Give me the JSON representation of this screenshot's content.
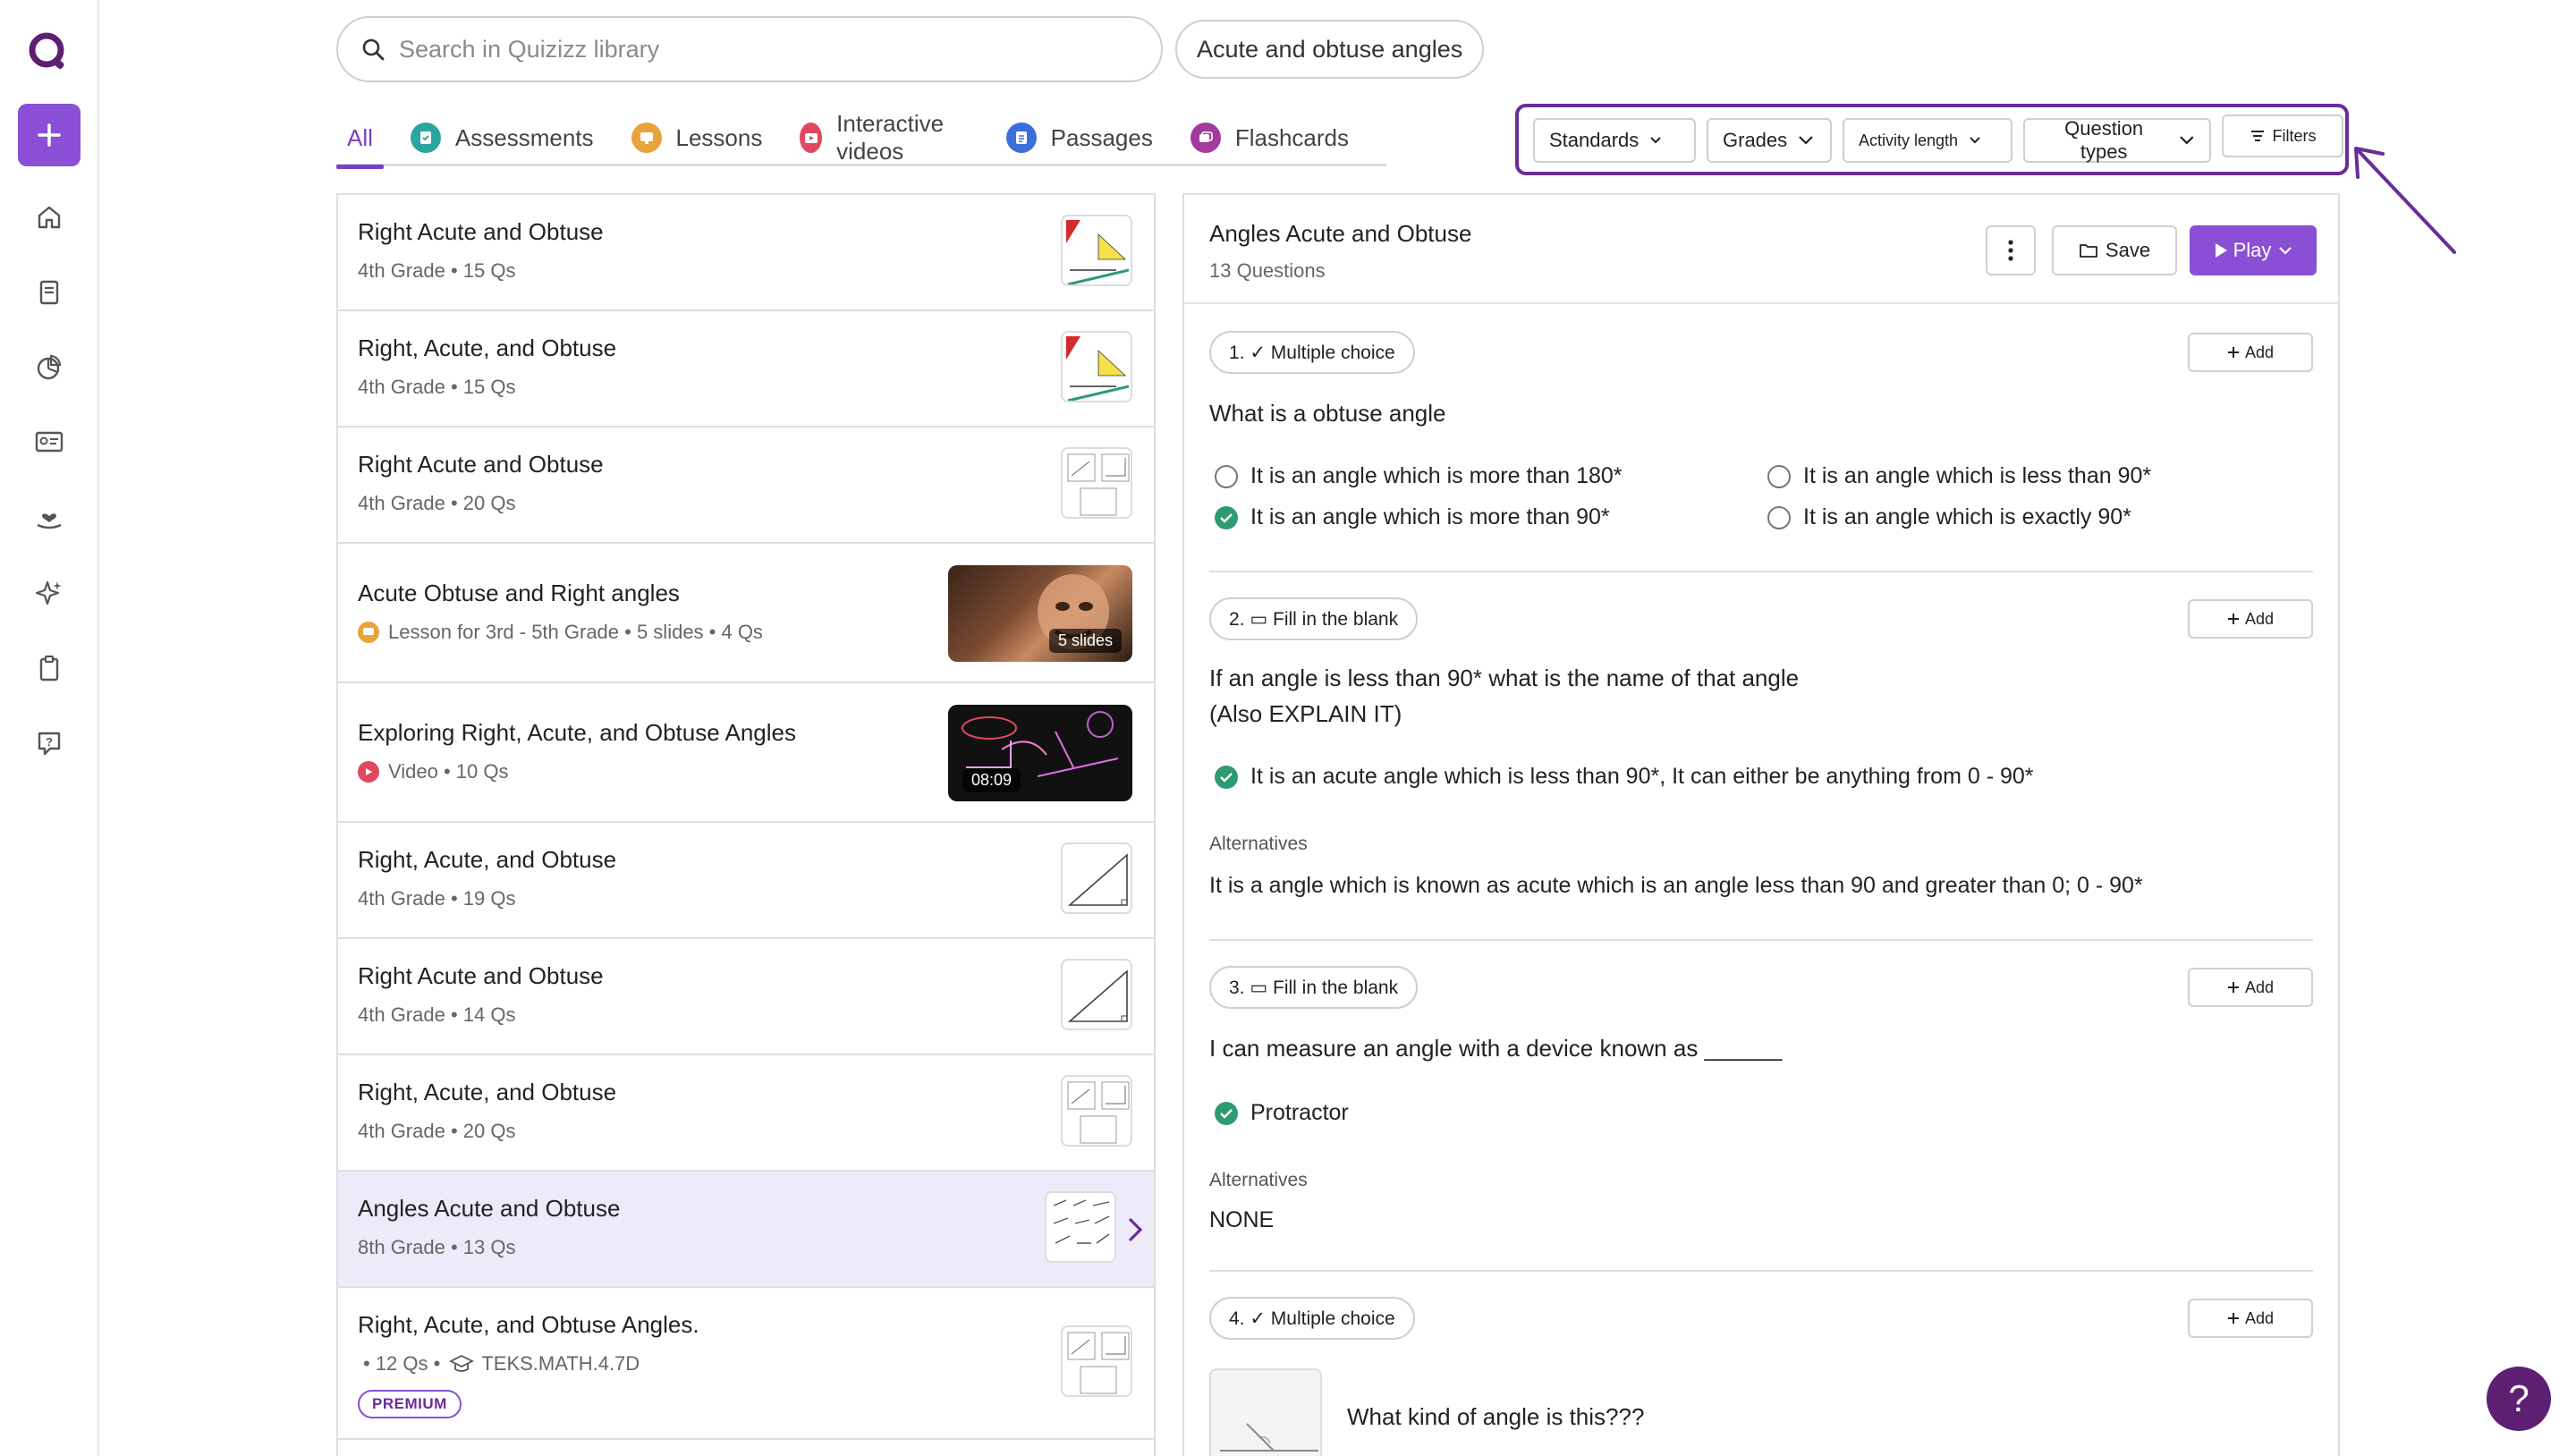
{
  "search": {
    "placeholder": "Search in Quizizz library"
  },
  "query_chip": "Acute and obtuse angles",
  "tabs": [
    {
      "label": "All",
      "color": "#7c3fc4"
    },
    {
      "label": "Assessments",
      "color": "#2aa6a0"
    },
    {
      "label": "Lessons",
      "color": "#e9a33b"
    },
    {
      "label": "Interactive videos",
      "color": "#e0485f"
    },
    {
      "label": "Passages",
      "color": "#3b6fd9"
    },
    {
      "label": "Flashcards",
      "color": "#a33a9e"
    }
  ],
  "filters": {
    "standards": "Standards",
    "grades": "Grades",
    "activity_length": "Activity length",
    "question_types": "Question types",
    "filters": "Filters"
  },
  "results": [
    {
      "title": "Right Acute and Obtuse",
      "meta": "4th Grade • 15 Qs"
    },
    {
      "title": "Right, Acute, and Obtuse",
      "meta": "4th Grade • 15 Qs"
    },
    {
      "title": "Right Acute and Obtuse",
      "meta": "4th Grade • 20 Qs"
    },
    {
      "title": "Acute Obtuse and Right angles",
      "meta": "Lesson for 3rd - 5th Grade • 5 slides • 4 Qs",
      "badge": "5 slides"
    },
    {
      "title": "Exploring Right, Acute, and Obtuse Angles",
      "meta": "Video • 10 Qs",
      "badge": "08:09"
    },
    {
      "title": "Right, Acute, and Obtuse",
      "meta": "4th Grade • 19 Qs"
    },
    {
      "title": "Right Acute and Obtuse",
      "meta": "4th Grade • 14 Qs"
    },
    {
      "title": "Right, Acute, and Obtuse",
      "meta": "4th Grade • 20 Qs"
    },
    {
      "title": "Angles Acute and Obtuse",
      "meta": "8th Grade • 13 Qs"
    },
    {
      "title": "Right, Acute, and Obtuse Angles.",
      "meta": "• 12 Qs •",
      "standard": "TEKS.MATH.4.7D",
      "premium": "PREMIUM"
    }
  ],
  "detail": {
    "title": "Angles Acute and Obtuse",
    "subtitle": "13 Questions",
    "save_label": "Save",
    "play_label": "Play",
    "add_label": "Add",
    "alternatives_label": "Alternatives",
    "questions": [
      {
        "type": "1. ✓ Multiple choice",
        "text": "What is a obtuse angle",
        "options": [
          "It is an angle which is more than 180*",
          "It is an angle which is less than 90*",
          "It is an angle which is more than 90*",
          "It is an angle which is exactly 90*"
        ]
      },
      {
        "type": "2. ▭ Fill in the blank",
        "text_line1": "If an angle is less than 90* what is the name of that angle",
        "text_line2": "(Also EXPLAIN IT)",
        "answer": "It is an acute angle which is less than 90*, It can either be anything from 0 - 90*",
        "alternative": "It is a angle which is known as acute which is an angle less than 90 and greater than 0; 0 - 90*"
      },
      {
        "type": "3. ▭ Fill in the blank",
        "text": "I can measure an angle with a device known as ______",
        "answer": "Protractor",
        "alternative": "NONE"
      },
      {
        "type": "4. ✓ Multiple choice",
        "text": "What kind of angle is this???"
      }
    ]
  },
  "colors": {
    "accent": "#8a4fd4",
    "correct": "#2e9b72",
    "annotation": "#6a2c97"
  }
}
